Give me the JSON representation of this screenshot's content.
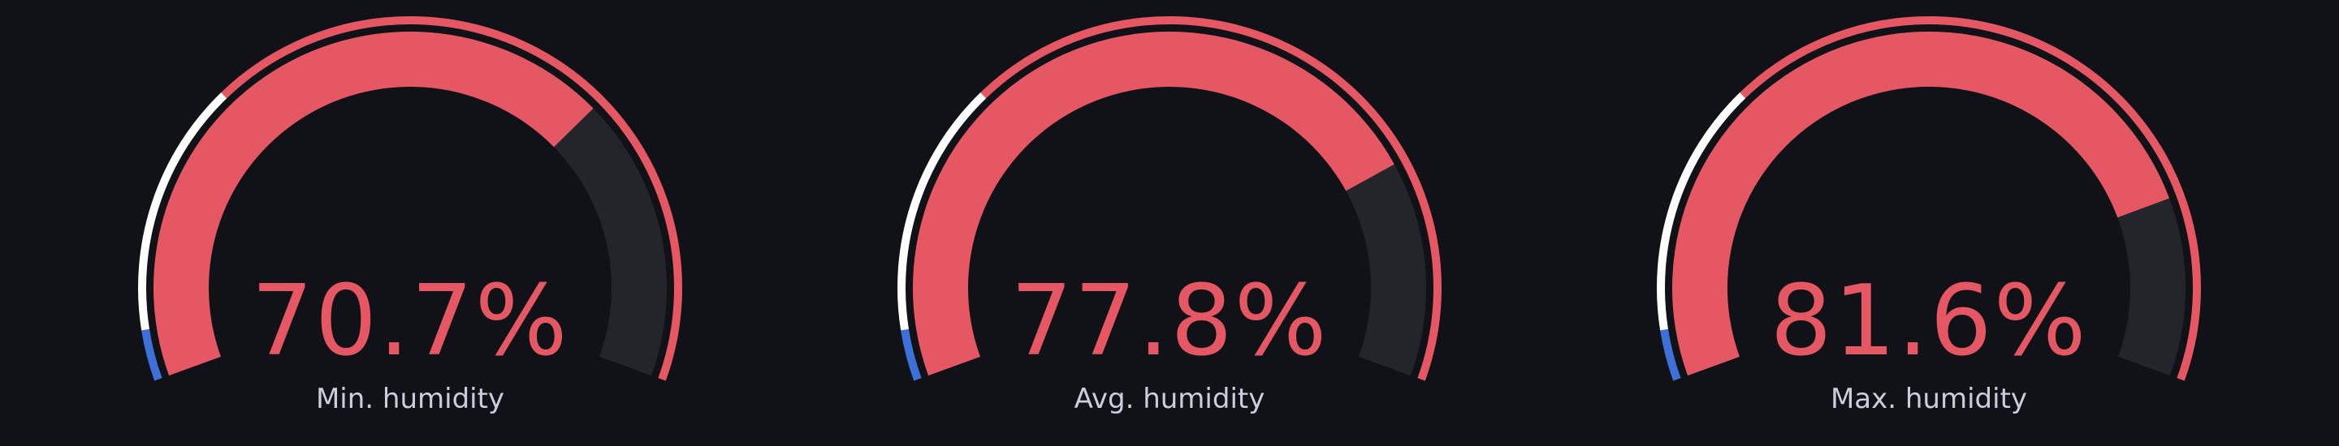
{
  "gauges": [
    {
      "value": 70.7,
      "unit": "%",
      "display": "70.7%",
      "label": "Min. humidity",
      "min": 0,
      "max": 100
    },
    {
      "value": 77.8,
      "unit": "%",
      "display": "77.8%",
      "label": "Avg. humidity",
      "min": 0,
      "max": 100
    },
    {
      "value": 81.6,
      "unit": "%",
      "display": "81.6%",
      "label": "Max. humidity",
      "min": 0,
      "max": 100
    }
  ],
  "thresholds": [
    {
      "from": 0,
      "to": 5,
      "color": "#3d71d9"
    },
    {
      "from": 5,
      "to": 30,
      "color": "#ffffff"
    },
    {
      "from": 30,
      "to": 100,
      "color": "#e55763"
    }
  ],
  "colors": {
    "background": "#111217",
    "value_color": "#e55763",
    "track": "#24252b",
    "label": "#ccccdc"
  }
}
